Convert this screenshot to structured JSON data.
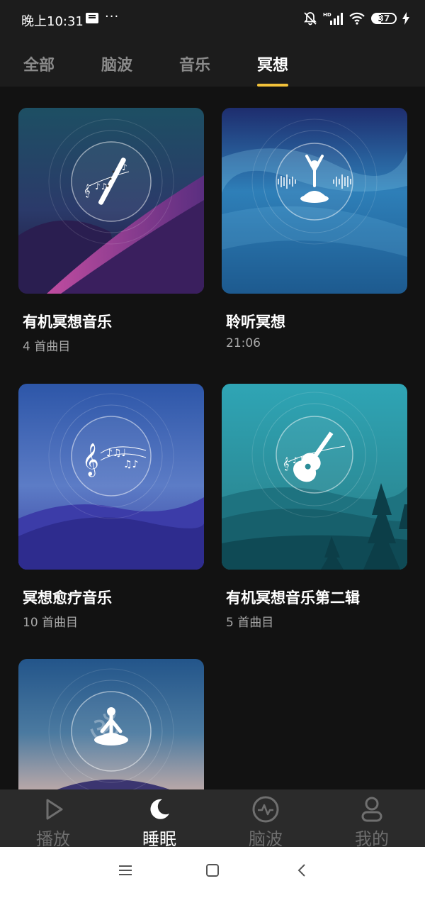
{
  "status_bar": {
    "time": "晚上10:31",
    "dots": "···",
    "network": "HD",
    "battery": "37"
  },
  "tabs": [
    {
      "label": "全部",
      "active": false
    },
    {
      "label": "脑波",
      "active": false
    },
    {
      "label": "音乐",
      "active": false
    },
    {
      "label": "冥想",
      "active": true
    }
  ],
  "cards": [
    {
      "title": "有机冥想音乐",
      "subtitle": "4 首曲目",
      "icon": "flute-music-icon"
    },
    {
      "title": "聆听冥想",
      "subtitle": "21:06",
      "icon": "meditation-soundwave-icon"
    },
    {
      "title": "冥想愈疗音乐",
      "subtitle": "10 首曲目",
      "icon": "music-notes-icon"
    },
    {
      "title": "有机冥想音乐第二辑",
      "subtitle": "5 首曲目",
      "icon": "guitar-music-icon"
    },
    {
      "title": "",
      "subtitle": "",
      "icon": "om-meditation-icon"
    }
  ],
  "bottom_nav": [
    {
      "label": "播放",
      "icon": "play-icon",
      "active": false
    },
    {
      "label": "睡眠",
      "icon": "moon-icon",
      "active": true
    },
    {
      "label": "脑波",
      "icon": "pulse-icon",
      "active": false
    },
    {
      "label": "我的",
      "icon": "user-icon",
      "active": false
    }
  ],
  "colors": {
    "accent": "#f2c23a",
    "background": "#121212",
    "bar": "#1c1c1c",
    "nav": "#2b2b2b"
  }
}
